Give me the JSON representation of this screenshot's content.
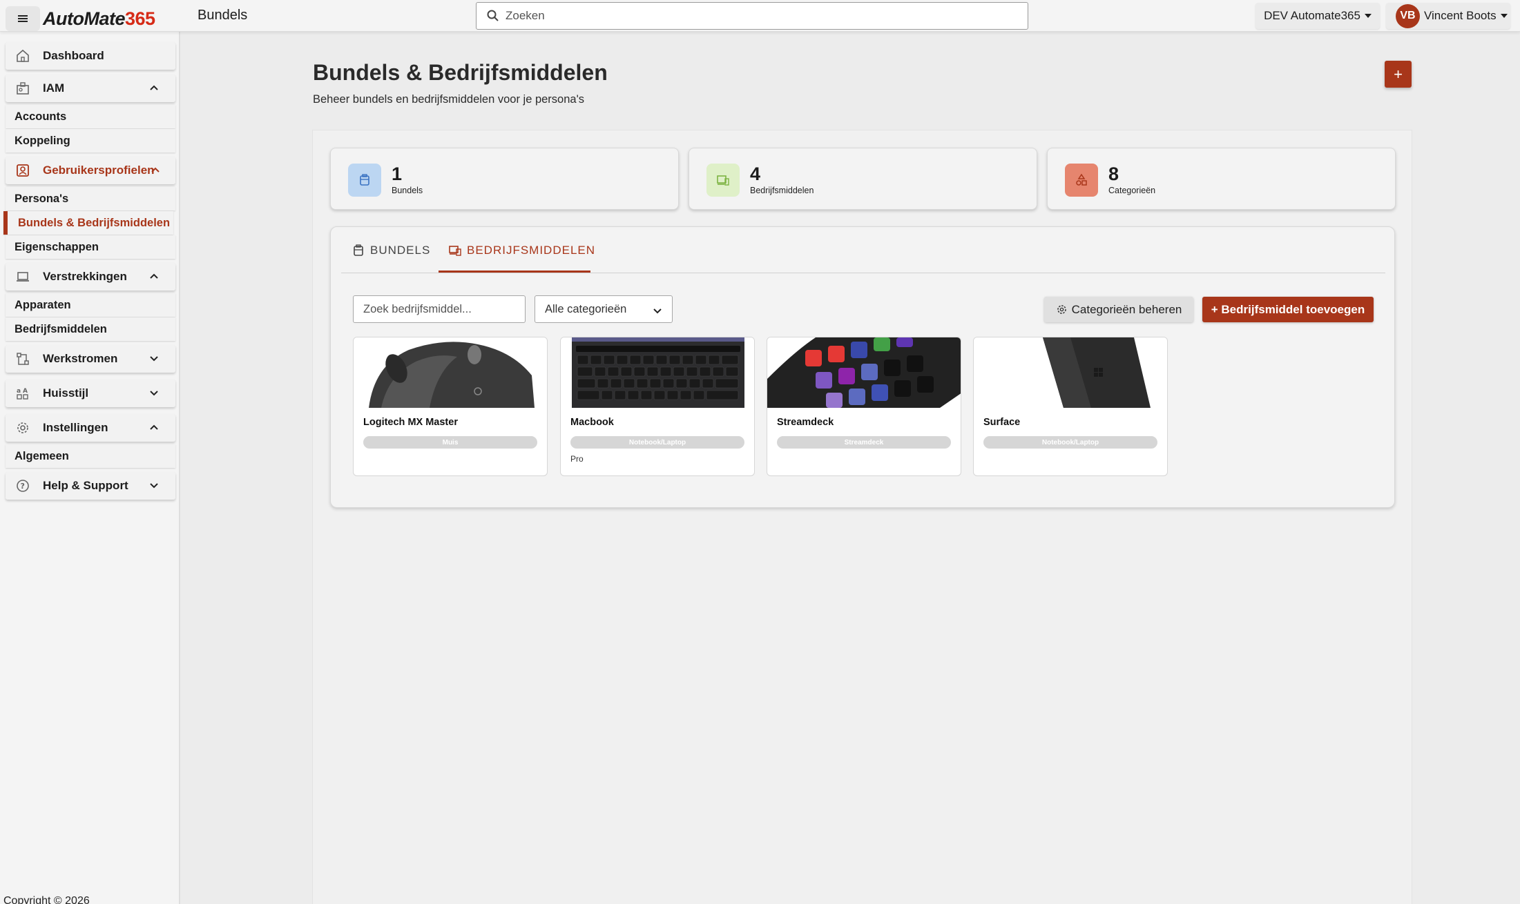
{
  "topbar": {
    "logo_part1": "AutoMate",
    "logo_part2": "365",
    "page_title": "Bundels",
    "search_placeholder": "Zoeken",
    "environment": "DEV Automate365",
    "user_initials": "VB",
    "user_name": "Vincent Boots"
  },
  "sidebar": {
    "dashboard": "Dashboard",
    "iam": {
      "label": "IAM",
      "items": [
        "Accounts",
        "Koppeling"
      ]
    },
    "profiles": {
      "label": "Gebruikersprofielen",
      "items": [
        "Persona's",
        "Bundels & Bedrijfsmiddelen",
        "Eigenschappen"
      ]
    },
    "provisioning": {
      "label": "Verstrekkingen",
      "items": [
        "Apparaten",
        "Bedrijfsmiddelen"
      ]
    },
    "workflows": "Werkstromen",
    "branding": "Huisstijl",
    "settings": {
      "label": "Instellingen",
      "items": [
        "Algemeen"
      ]
    },
    "help": "Help & Support",
    "copyright": "Copyright © 2026"
  },
  "main": {
    "heading": "Bundels & Bedrijfsmiddelen",
    "subheading": "Beheer bundels en bedrijfsmiddelen voor je persona's",
    "add_label": "+"
  },
  "stats": [
    {
      "value": "1",
      "label": "Bundels",
      "color": "#bcd6f2"
    },
    {
      "value": "4",
      "label": "Bedrijfsmiddelen",
      "color": "#dff0c8"
    },
    {
      "value": "8",
      "label": "Categorieën",
      "color": "#e6856e"
    }
  ],
  "tabs": [
    {
      "label": "BUNDELS"
    },
    {
      "label": "BEDRIJFSMIDDELEN"
    }
  ],
  "filters": {
    "search_placeholder": "Zoek bedrijfsmiddel...",
    "category_selected": "Alle categorieën",
    "manage_categories": "Categorieën beheren",
    "add_asset": "+ Bedrijfsmiddel toevoegen"
  },
  "assets": [
    {
      "name": "Logitech MX Master",
      "category": "Muis",
      "description": ""
    },
    {
      "name": "Macbook",
      "category": "Notebook/Laptop",
      "description": "Pro"
    },
    {
      "name": "Streamdeck",
      "category": "Streamdeck",
      "description": ""
    },
    {
      "name": "Surface",
      "category": "Notebook/Laptop",
      "description": ""
    }
  ],
  "colors": {
    "accent": "#a8361a",
    "logo_red": "#d62b17"
  }
}
